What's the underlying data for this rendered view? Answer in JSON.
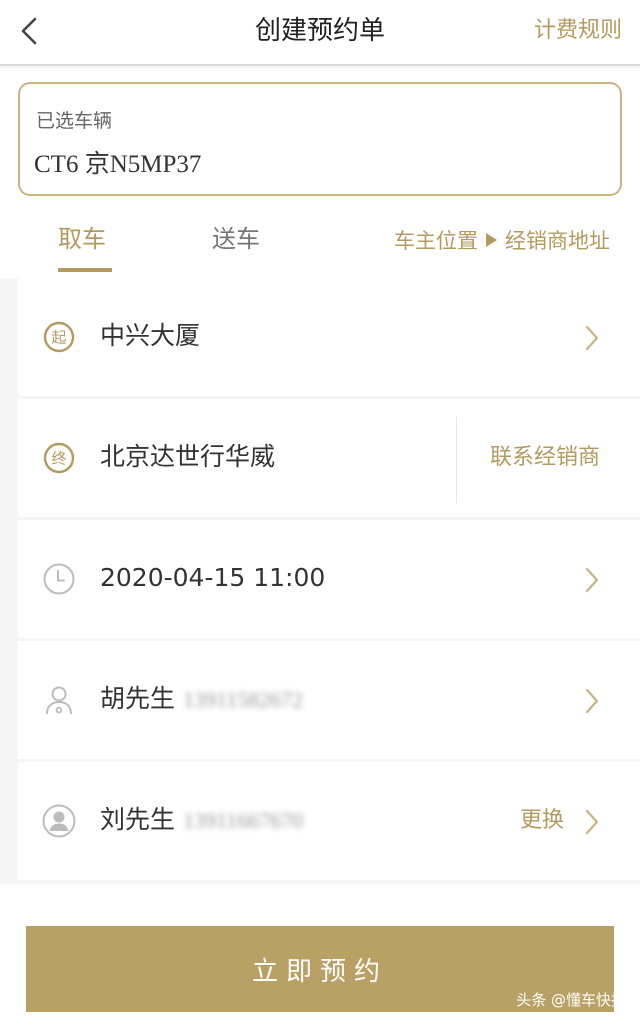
{
  "header": {
    "title": "创建预约单",
    "rules_label": "计费规则"
  },
  "vehicle": {
    "label": "已选车辆",
    "plate": "CT6 京N5MP37"
  },
  "tabs": [
    {
      "label": "取车",
      "active": true
    },
    {
      "label": "送车",
      "active": false
    }
  ],
  "route": {
    "from": "车主位置",
    "to": "经销商地址"
  },
  "rows": {
    "start": {
      "badge": "起",
      "text": "中兴大厦"
    },
    "end": {
      "badge": "终",
      "text": "北京达世行华威",
      "action": "联系经销商"
    },
    "time": {
      "text": "2020-04-15 11:00"
    },
    "owner": {
      "name": "胡先生",
      "phone": "13911582672"
    },
    "driver": {
      "name": "刘先生",
      "phone": "13911667670",
      "action": "更换"
    }
  },
  "cta": {
    "label": "立即预约"
  },
  "watermark": "头条 @懂车快报",
  "colors": {
    "accent": "#b39a5f",
    "button": "#b9a064"
  }
}
